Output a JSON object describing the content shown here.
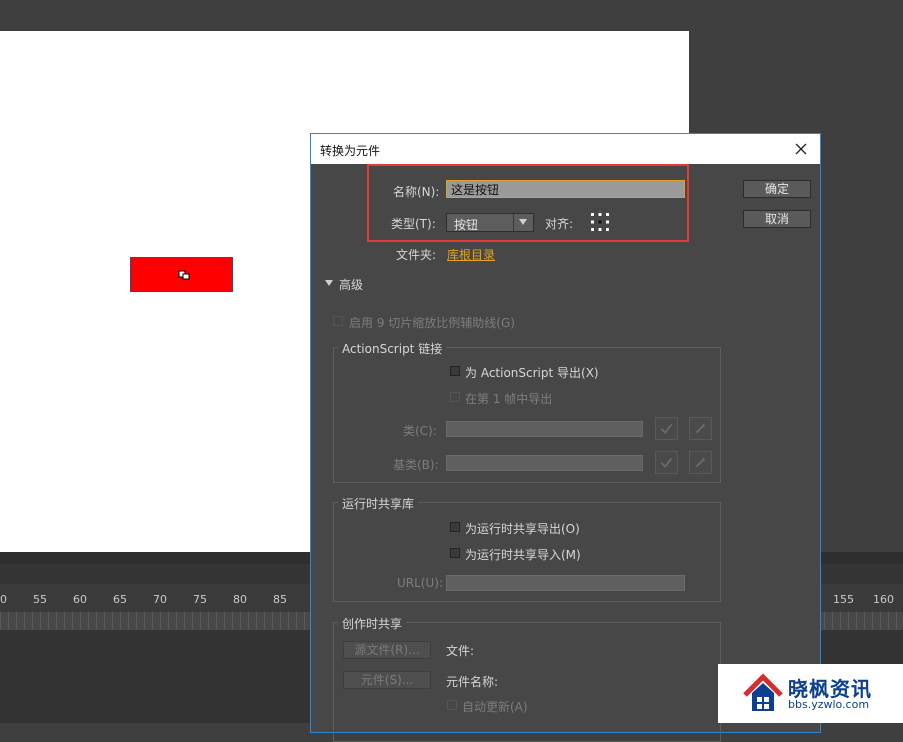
{
  "timeline": {
    "ticks": [
      "0",
      "55",
      "60",
      "65",
      "70",
      "75",
      "80",
      "85",
      "155",
      "160"
    ]
  },
  "dialog": {
    "title": "转换为元件",
    "name_label": "名称(N):",
    "name_value": "这是按钮",
    "type_label": "类型(T):",
    "type_value": "按钮",
    "align_label": "对齐:",
    "folder_label": "文件夹:",
    "folder_value": "库根目录",
    "ok_label": "确定",
    "cancel_label": "取消",
    "advanced_label": "高级",
    "scale9_label": "启用 9 切片缩放比例辅助线(G)",
    "as_linkage": {
      "title": "ActionScript 链接",
      "export_as": "为 ActionScript 导出(X)",
      "export_frame1": "在第 1 帧中导出",
      "class_label": "类(C):",
      "base_class_label": "基类(B):"
    },
    "runtime_share": {
      "title": "运行时共享库",
      "export_label": "为运行时共享导出(O)",
      "import_label": "为运行时共享导入(M)",
      "url_label": "URL(U):"
    },
    "authoring_share": {
      "title": "创作时共享",
      "source_file_button": "源文件(R)...",
      "file_label": "文件:",
      "symbol_button": "元件(S)...",
      "symbol_name_label": "元件名称:",
      "auto_update_label": "自动更新(A)"
    }
  },
  "watermark": {
    "title": "晓枫资讯",
    "url": "bbs.yzwlo.com"
  },
  "colors": {
    "highlight": "#e53935",
    "link": "#e6a218",
    "accent_border": "#2b88d8",
    "symbol_fill": "#ff0000"
  }
}
